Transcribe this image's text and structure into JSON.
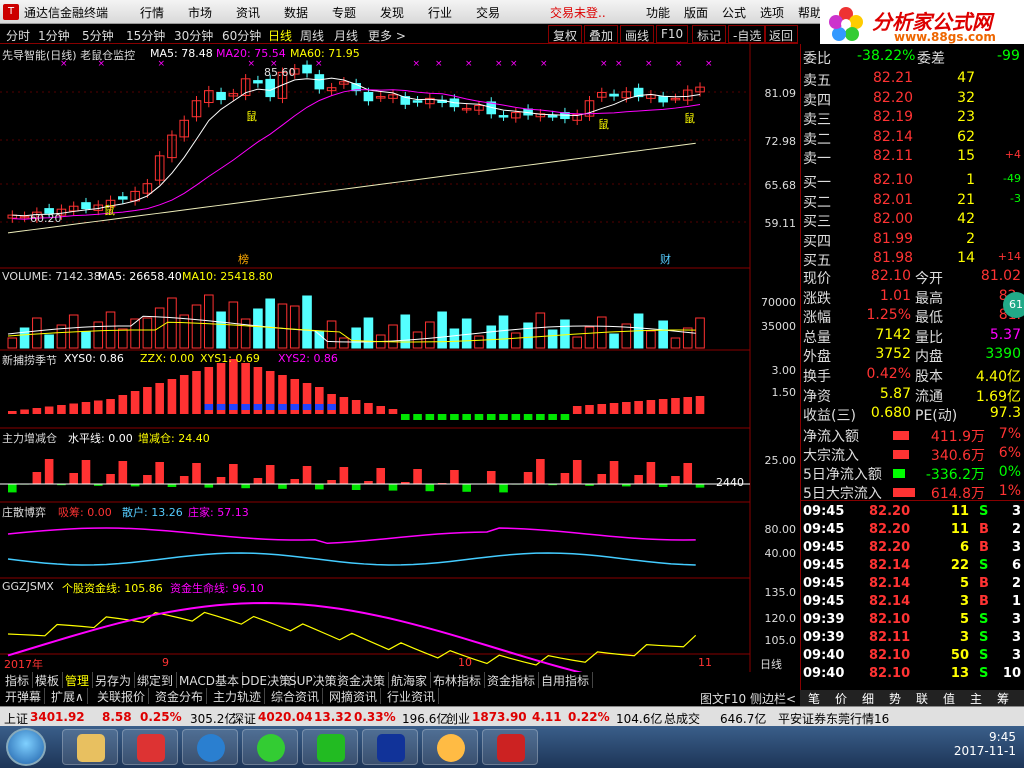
{
  "app": {
    "title": "通达信金融终端",
    "menu": [
      "行情",
      "市场",
      "资讯",
      "数据",
      "专题",
      "发现",
      "行业",
      "交易",
      "交易未登..",
      "功能",
      "版面",
      "公式",
      "选项",
      "帮助"
    ]
  },
  "logo": {
    "name": "分析家公式网",
    "url": "www.88gs.com"
  },
  "periods": [
    "分时",
    "1分钟",
    "5分钟",
    "15分钟",
    "30分钟",
    "60分钟",
    "日线",
    "周线",
    "月线",
    "更多 >"
  ],
  "active_period": "日线",
  "toolbar": [
    "复权",
    "叠加",
    "画线",
    "F10",
    "标记",
    "-自选",
    "返回"
  ],
  "main_chart": {
    "title": "先导智能(日线) 老鼠仓监控",
    "ma5": "MA5: 78.48",
    "ma20": "MA20: 75.54",
    "ma60": "MA60: 71.95",
    "high_label": "85.60",
    "low_label": "60.20",
    "y_ticks": [
      "81.09",
      "72.98",
      "65.68",
      "59.11"
    ],
    "marker_rat": "鼠",
    "marker_bang": "榜",
    "marker_cai": "财"
  },
  "volume": {
    "title": "VOLUME: 7142.38",
    "ma5": "MA5: 26658.40",
    "ma10": "MA10: 25418.80",
    "y_ticks": [
      "70000",
      "35000"
    ]
  },
  "indicator1": {
    "title": "新捕捞季节",
    "xys0": "XYS0: 0.86",
    "zzx": "ZZX: 0.00",
    "xys1": "XYS1: 0.69",
    "xys2": "XYS2: 0.86",
    "y_ticks": [
      "3.00",
      "1.50"
    ]
  },
  "indicator2": {
    "title": "主力增减仓",
    "level": "水平线: 0.00",
    "change": "增减仓: 24.40",
    "y_ticks": [
      "25.00"
    ],
    "value_label": "2440"
  },
  "indicator3": {
    "title": "庄散博弈",
    "chip": "吸筹: 0.00",
    "retail": "散户: 13.26",
    "dealer": "庄家: 57.13",
    "y_ticks": [
      "80.00",
      "40.00"
    ]
  },
  "indicator4": {
    "title": "GGZJSMX",
    "fund": "个股资金线: 105.86",
    "life": "资金生命线: 96.10",
    "y_ticks": [
      "135.0",
      "120.0",
      "105.0"
    ]
  },
  "time_axis": {
    "year": "2017年",
    "m9": "9",
    "m10": "10",
    "m11": "11",
    "mode": "日线"
  },
  "colors": {
    "up": "#ff3232",
    "down": "#54ffff",
    "yellow": "#ffff00",
    "magenta": "#ff00ff",
    "white": "#ffffff",
    "green": "#00e600"
  },
  "quote": {
    "weibi_label": "委比",
    "weibi": "-38.22%",
    "weicha_label": "委差",
    "weicha": "-99",
    "asks": [
      {
        "label": "卖五",
        "price": "82.21",
        "vol": "47",
        "chg": ""
      },
      {
        "label": "卖四",
        "price": "82.20",
        "vol": "32",
        "chg": ""
      },
      {
        "label": "卖三",
        "price": "82.19",
        "vol": "23",
        "chg": ""
      },
      {
        "label": "卖二",
        "price": "82.14",
        "vol": "62",
        "chg": ""
      },
      {
        "label": "卖一",
        "price": "82.11",
        "vol": "15",
        "chg": "+4"
      }
    ],
    "bids": [
      {
        "label": "买一",
        "price": "82.10",
        "vol": "1",
        "chg": "-49"
      },
      {
        "label": "买二",
        "price": "82.01",
        "vol": "21",
        "chg": "-3"
      },
      {
        "label": "买三",
        "price": "82.00",
        "vol": "42",
        "chg": ""
      },
      {
        "label": "买四",
        "price": "81.99",
        "vol": "2",
        "chg": ""
      },
      {
        "label": "买五",
        "price": "81.98",
        "vol": "14",
        "chg": "+14"
      }
    ],
    "stats": [
      {
        "l1": "现价",
        "v1": "82.10",
        "l2": "今开",
        "v2": "81.02"
      },
      {
        "l1": "涨跌",
        "v1": "1.01",
        "l2": "最高",
        "v2": "82."
      },
      {
        "l1": "涨幅",
        "v1": "1.25%",
        "l2": "最低",
        "v2": "81."
      },
      {
        "l1": "总量",
        "v1": "7142",
        "l2": "量比",
        "v2": "5.37"
      },
      {
        "l1": "外盘",
        "v1": "3752",
        "l2": "内盘",
        "v2": "3390"
      }
    ],
    "stats2": [
      {
        "l1": "换手",
        "v1": "0.42%",
        "l2": "股本",
        "v2": "4.40亿"
      },
      {
        "l1": "净资",
        "v1": "5.87",
        "l2": "流通",
        "v2": "1.69亿"
      },
      {
        "l1": "收益(三)",
        "v1": "0.680",
        "l2": "PE(动)",
        "v2": "97.3"
      }
    ],
    "flows": [
      {
        "label": "净流入额",
        "val": "411.9万",
        "pct": "7%",
        "dir": "up"
      },
      {
        "label": "大宗流入",
        "val": "340.6万",
        "pct": "6%",
        "dir": "up"
      },
      {
        "label": "5日净流入额",
        "val": "-336.2万",
        "pct": "0%",
        "dir": "down"
      },
      {
        "label": "5日大宗流入",
        "val": "614.8万",
        "pct": "1%",
        "dir": "up"
      }
    ],
    "ticks": [
      {
        "t": "09:45",
        "p": "82.20",
        "v": "11",
        "s": "S",
        "n": "3"
      },
      {
        "t": "09:45",
        "p": "82.20",
        "v": "11",
        "s": "B",
        "n": "2"
      },
      {
        "t": "09:45",
        "p": "82.20",
        "v": "6",
        "s": "B",
        "n": "3"
      },
      {
        "t": "09:45",
        "p": "82.14",
        "v": "22",
        "s": "S",
        "n": "6"
      },
      {
        "t": "09:45",
        "p": "82.14",
        "v": "5",
        "s": "B",
        "n": "2"
      },
      {
        "t": "09:45",
        "p": "82.14",
        "v": "3",
        "s": "B",
        "n": "1"
      },
      {
        "t": "09:39",
        "p": "82.10",
        "v": "5",
        "s": "S",
        "n": "3"
      },
      {
        "t": "09:39",
        "p": "82.11",
        "v": "3",
        "s": "S",
        "n": "3"
      },
      {
        "t": "09:40",
        "p": "82.10",
        "v": "50",
        "s": "S",
        "n": "3"
      },
      {
        "t": "09:40",
        "p": "82.10",
        "v": "13",
        "s": "S",
        "n": "10"
      }
    ],
    "side_badge": "61"
  },
  "bottom_tabs1": [
    "指标",
    "模板",
    "管理",
    "另存为",
    "绑定到",
    "MACD基本",
    "DDE决策",
    "SUP决策",
    "资金决策",
    "航海家",
    "布林指标",
    "资金指标",
    "自用指标"
  ],
  "bottom_tabs2": [
    "开弹幕",
    "扩展∧",
    "关联报价",
    "资金分布",
    "主力轨迹",
    "综合资讯",
    "网摘资讯",
    "行业资讯"
  ],
  "bottom_right": [
    "图文F10",
    "侧边栏<"
  ],
  "right_tabs": [
    "笔",
    "价",
    "细",
    "势",
    "联",
    "值",
    "主",
    "筹"
  ],
  "status": {
    "sh_label": "上证",
    "sh": "3401.92",
    "sh_chg": "8.58",
    "sh_pct": "0.25%",
    "sh_amt": "305.2亿",
    "sz_label": "深证",
    "sz": "4020.04",
    "sz_chg": "13.32",
    "sz_pct": "0.33%",
    "sz_amt": "196.6亿",
    "cy_label": "创业",
    "cy": "1873.90",
    "cy_chg": "4.11",
    "cy_pct": "0.22%",
    "cy_amt": "104.6亿",
    "total_label": "总成交",
    "total": "646.7亿",
    "broker": "平安证券东莞行情16"
  },
  "clock": {
    "time": "9:45",
    "date": "2017-11-1"
  }
}
